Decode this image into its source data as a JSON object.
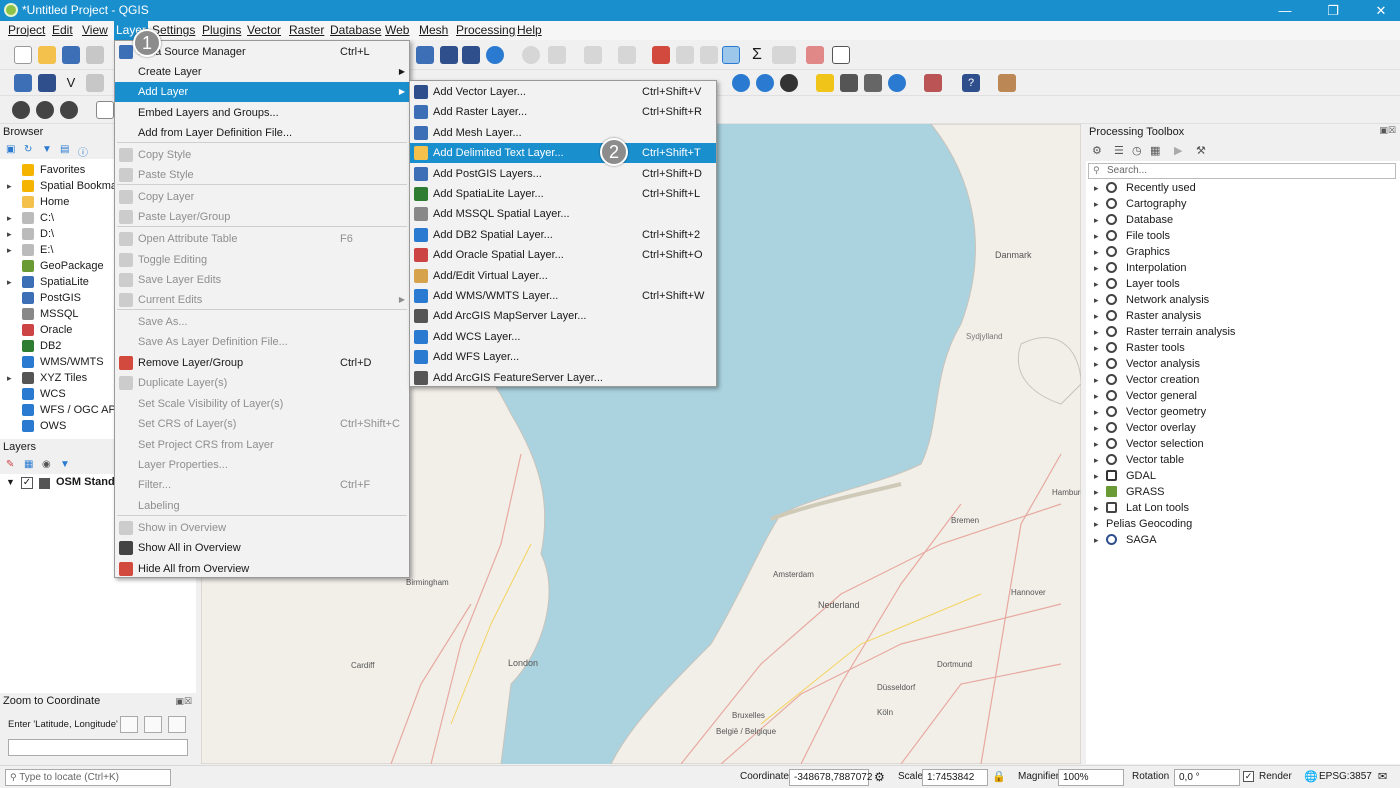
{
  "window": {
    "title": "*Untitled Project - QGIS"
  },
  "menubar": [
    "Project",
    "Edit",
    "View",
    "Layer",
    "Settings",
    "Plugins",
    "Vector",
    "Raster",
    "Database",
    "Web",
    "Mesh",
    "Processing",
    "Help"
  ],
  "browser": {
    "title": "Browser",
    "items": [
      "Favorites",
      "Spatial Bookma",
      "Home",
      "C:\\",
      "D:\\",
      "E:\\",
      "GeoPackage",
      "SpatiaLite",
      "PostGIS",
      "MSSQL",
      "Oracle",
      "DB2",
      "WMS/WMTS",
      "XYZ Tiles",
      "WCS",
      "WFS / OGC API",
      "OWS"
    ]
  },
  "layers": {
    "title": "Layers",
    "items": [
      "OSM Stand"
    ]
  },
  "zoom": {
    "title": "Zoom to Coordinate",
    "label": "Enter 'Latitude, Longitude'"
  },
  "locator": {
    "placeholder": "Type to locate (Ctrl+K)"
  },
  "layer_menu": [
    {
      "label": "Data Source Manager",
      "shortcut": "Ctrl+L"
    },
    {
      "label": "Create Layer",
      "shortcut": ""
    },
    {
      "label": "Add Layer",
      "shortcut": ""
    },
    {
      "label": "Embed Layers and Groups...",
      "shortcut": ""
    },
    {
      "label": "Add from Layer Definition File...",
      "shortcut": ""
    },
    {
      "label": "Copy Style",
      "shortcut": ""
    },
    {
      "label": "Paste Style",
      "shortcut": ""
    },
    {
      "label": "Copy Layer",
      "shortcut": ""
    },
    {
      "label": "Paste Layer/Group",
      "shortcut": ""
    },
    {
      "label": "Open Attribute Table",
      "shortcut": "F6"
    },
    {
      "label": "Toggle Editing",
      "shortcut": ""
    },
    {
      "label": "Save Layer Edits",
      "shortcut": ""
    },
    {
      "label": "Current Edits",
      "shortcut": ""
    },
    {
      "label": "Save As...",
      "shortcut": ""
    },
    {
      "label": "Save As Layer Definition File...",
      "shortcut": ""
    },
    {
      "label": "Remove Layer/Group",
      "shortcut": "Ctrl+D"
    },
    {
      "label": "Duplicate Layer(s)",
      "shortcut": ""
    },
    {
      "label": "Set Scale Visibility of Layer(s)",
      "shortcut": ""
    },
    {
      "label": "Set CRS of Layer(s)",
      "shortcut": "Ctrl+Shift+C"
    },
    {
      "label": "Set Project CRS from Layer",
      "shortcut": ""
    },
    {
      "label": "Layer Properties...",
      "shortcut": ""
    },
    {
      "label": "Filter...",
      "shortcut": "Ctrl+F"
    },
    {
      "label": "Labeling",
      "shortcut": ""
    },
    {
      "label": "Show in Overview",
      "shortcut": ""
    },
    {
      "label": "Show All in Overview",
      "shortcut": ""
    },
    {
      "label": "Hide All from Overview",
      "shortcut": ""
    }
  ],
  "add_layer_menu": [
    {
      "label": "Add Vector Layer...",
      "shortcut": "Ctrl+Shift+V"
    },
    {
      "label": "Add Raster Layer...",
      "shortcut": "Ctrl+Shift+R"
    },
    {
      "label": "Add Mesh Layer...",
      "shortcut": ""
    },
    {
      "label": "Add Delimited Text Layer...",
      "shortcut": "Ctrl+Shift+T"
    },
    {
      "label": "Add PostGIS Layers...",
      "shortcut": "Ctrl+Shift+D"
    },
    {
      "label": "Add SpatiaLite Layer...",
      "shortcut": "Ctrl+Shift+L"
    },
    {
      "label": "Add MSSQL Spatial Layer...",
      "shortcut": ""
    },
    {
      "label": "Add DB2 Spatial Layer...",
      "shortcut": "Ctrl+Shift+2"
    },
    {
      "label": "Add Oracle Spatial Layer...",
      "shortcut": "Ctrl+Shift+O"
    },
    {
      "label": "Add/Edit Virtual Layer...",
      "shortcut": ""
    },
    {
      "label": "Add WMS/WMTS Layer...",
      "shortcut": "Ctrl+Shift+W"
    },
    {
      "label": "Add ArcGIS MapServer Layer...",
      "shortcut": ""
    },
    {
      "label": "Add WCS Layer...",
      "shortcut": ""
    },
    {
      "label": "Add WFS Layer...",
      "shortcut": ""
    },
    {
      "label": "Add ArcGIS FeatureServer Layer...",
      "shortcut": ""
    }
  ],
  "badges": [
    "1",
    "2"
  ],
  "processing": {
    "title": "Processing Toolbox",
    "search_placeholder": "Search...",
    "items": [
      "Recently used",
      "Cartography",
      "Database",
      "File tools",
      "Graphics",
      "Interpolation",
      "Layer tools",
      "Network analysis",
      "Raster analysis",
      "Raster terrain analysis",
      "Raster tools",
      "Vector analysis",
      "Vector creation",
      "Vector general",
      "Vector geometry",
      "Vector overlay",
      "Vector selection",
      "Vector table",
      "GDAL",
      "GRASS",
      "Lat Lon tools",
      "Pelias Geocoding",
      "SAGA"
    ]
  },
  "map_labels": [
    "Danmark",
    "Sydjylland",
    "Hamburg",
    "Nederland",
    "Bremen",
    "Hannover",
    "Amsterdam",
    "Birmingham",
    "London",
    "Cardiff",
    "Bruxelles",
    "België / Belgique",
    "Düsseldorf",
    "Köln",
    "Dortmund"
  ],
  "status": {
    "coordinate_label": "Coordinate",
    "coordinate": "-348678,7887072",
    "scale_label": "Scale",
    "scale": "1:7453842",
    "magnifier_label": "Magnifier",
    "magnifier": "100%",
    "rotation_label": "Rotation",
    "rotation": "0,0 °",
    "render_label": "Render",
    "crs": "EPSG:3857"
  },
  "colors": {
    "accent": "#1a8fce",
    "sea": "#aad3df",
    "land": "#f2efe9"
  }
}
